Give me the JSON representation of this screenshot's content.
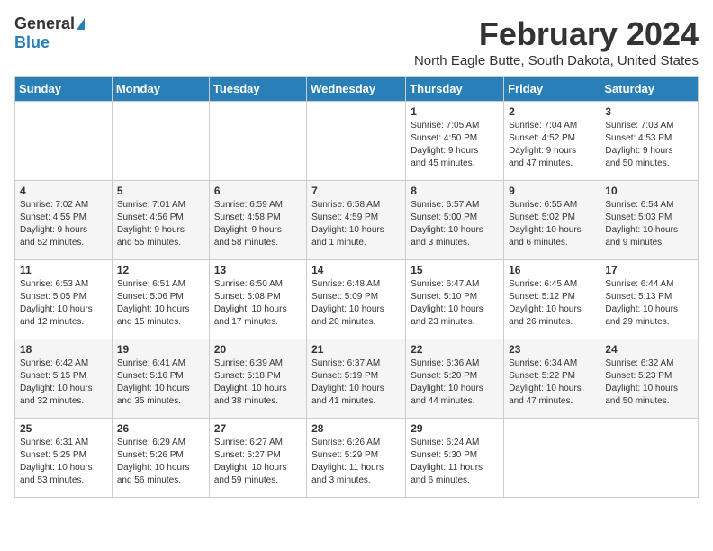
{
  "logo": {
    "general": "General",
    "blue": "Blue"
  },
  "title": "February 2024",
  "location": "North Eagle Butte, South Dakota, United States",
  "days_of_week": [
    "Sunday",
    "Monday",
    "Tuesday",
    "Wednesday",
    "Thursday",
    "Friday",
    "Saturday"
  ],
  "weeks": [
    [
      {
        "day": "",
        "info": ""
      },
      {
        "day": "",
        "info": ""
      },
      {
        "day": "",
        "info": ""
      },
      {
        "day": "",
        "info": ""
      },
      {
        "day": "1",
        "info": "Sunrise: 7:05 AM\nSunset: 4:50 PM\nDaylight: 9 hours\nand 45 minutes."
      },
      {
        "day": "2",
        "info": "Sunrise: 7:04 AM\nSunset: 4:52 PM\nDaylight: 9 hours\nand 47 minutes."
      },
      {
        "day": "3",
        "info": "Sunrise: 7:03 AM\nSunset: 4:53 PM\nDaylight: 9 hours\nand 50 minutes."
      }
    ],
    [
      {
        "day": "4",
        "info": "Sunrise: 7:02 AM\nSunset: 4:55 PM\nDaylight: 9 hours\nand 52 minutes."
      },
      {
        "day": "5",
        "info": "Sunrise: 7:01 AM\nSunset: 4:56 PM\nDaylight: 9 hours\nand 55 minutes."
      },
      {
        "day": "6",
        "info": "Sunrise: 6:59 AM\nSunset: 4:58 PM\nDaylight: 9 hours\nand 58 minutes."
      },
      {
        "day": "7",
        "info": "Sunrise: 6:58 AM\nSunset: 4:59 PM\nDaylight: 10 hours\nand 1 minute."
      },
      {
        "day": "8",
        "info": "Sunrise: 6:57 AM\nSunset: 5:00 PM\nDaylight: 10 hours\nand 3 minutes."
      },
      {
        "day": "9",
        "info": "Sunrise: 6:55 AM\nSunset: 5:02 PM\nDaylight: 10 hours\nand 6 minutes."
      },
      {
        "day": "10",
        "info": "Sunrise: 6:54 AM\nSunset: 5:03 PM\nDaylight: 10 hours\nand 9 minutes."
      }
    ],
    [
      {
        "day": "11",
        "info": "Sunrise: 6:53 AM\nSunset: 5:05 PM\nDaylight: 10 hours\nand 12 minutes."
      },
      {
        "day": "12",
        "info": "Sunrise: 6:51 AM\nSunset: 5:06 PM\nDaylight: 10 hours\nand 15 minutes."
      },
      {
        "day": "13",
        "info": "Sunrise: 6:50 AM\nSunset: 5:08 PM\nDaylight: 10 hours\nand 17 minutes."
      },
      {
        "day": "14",
        "info": "Sunrise: 6:48 AM\nSunset: 5:09 PM\nDaylight: 10 hours\nand 20 minutes."
      },
      {
        "day": "15",
        "info": "Sunrise: 6:47 AM\nSunset: 5:10 PM\nDaylight: 10 hours\nand 23 minutes."
      },
      {
        "day": "16",
        "info": "Sunrise: 6:45 AM\nSunset: 5:12 PM\nDaylight: 10 hours\nand 26 minutes."
      },
      {
        "day": "17",
        "info": "Sunrise: 6:44 AM\nSunset: 5:13 PM\nDaylight: 10 hours\nand 29 minutes."
      }
    ],
    [
      {
        "day": "18",
        "info": "Sunrise: 6:42 AM\nSunset: 5:15 PM\nDaylight: 10 hours\nand 32 minutes."
      },
      {
        "day": "19",
        "info": "Sunrise: 6:41 AM\nSunset: 5:16 PM\nDaylight: 10 hours\nand 35 minutes."
      },
      {
        "day": "20",
        "info": "Sunrise: 6:39 AM\nSunset: 5:18 PM\nDaylight: 10 hours\nand 38 minutes."
      },
      {
        "day": "21",
        "info": "Sunrise: 6:37 AM\nSunset: 5:19 PM\nDaylight: 10 hours\nand 41 minutes."
      },
      {
        "day": "22",
        "info": "Sunrise: 6:36 AM\nSunset: 5:20 PM\nDaylight: 10 hours\nand 44 minutes."
      },
      {
        "day": "23",
        "info": "Sunrise: 6:34 AM\nSunset: 5:22 PM\nDaylight: 10 hours\nand 47 minutes."
      },
      {
        "day": "24",
        "info": "Sunrise: 6:32 AM\nSunset: 5:23 PM\nDaylight: 10 hours\nand 50 minutes."
      }
    ],
    [
      {
        "day": "25",
        "info": "Sunrise: 6:31 AM\nSunset: 5:25 PM\nDaylight: 10 hours\nand 53 minutes."
      },
      {
        "day": "26",
        "info": "Sunrise: 6:29 AM\nSunset: 5:26 PM\nDaylight: 10 hours\nand 56 minutes."
      },
      {
        "day": "27",
        "info": "Sunrise: 6:27 AM\nSunset: 5:27 PM\nDaylight: 10 hours\nand 59 minutes."
      },
      {
        "day": "28",
        "info": "Sunrise: 6:26 AM\nSunset: 5:29 PM\nDaylight: 11 hours\nand 3 minutes."
      },
      {
        "day": "29",
        "info": "Sunrise: 6:24 AM\nSunset: 5:30 PM\nDaylight: 11 hours\nand 6 minutes."
      },
      {
        "day": "",
        "info": ""
      },
      {
        "day": "",
        "info": ""
      }
    ]
  ]
}
